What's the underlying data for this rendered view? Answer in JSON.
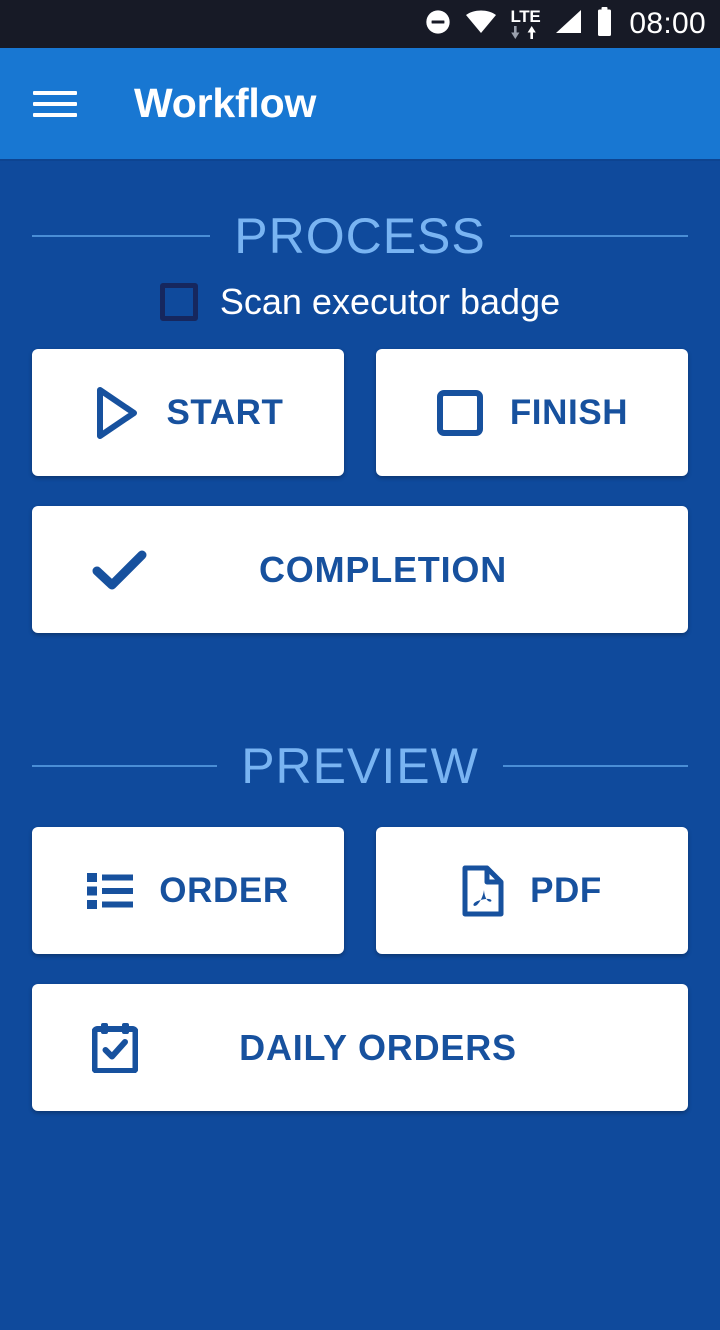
{
  "status_bar": {
    "time": "08:00",
    "lte_label": "LTE",
    "icons": [
      "do-not-disturb-icon",
      "wifi-icon",
      "lte-data-icon",
      "signal-icon",
      "battery-icon"
    ]
  },
  "app_bar": {
    "title": "Workflow",
    "menu_icon": "hamburger-menu-icon"
  },
  "sections": [
    {
      "title": "PROCESS",
      "checkbox": {
        "label": "Scan executor badge",
        "checked": false
      },
      "buttons": [
        {
          "label": "START",
          "icon": "play-icon"
        },
        {
          "label": "FINISH",
          "icon": "stop-square-icon"
        },
        {
          "label": "COMPLETION",
          "icon": "check-icon"
        }
      ]
    },
    {
      "title": "PREVIEW",
      "buttons": [
        {
          "label": "ORDER",
          "icon": "list-icon"
        },
        {
          "label": "PDF",
          "icon": "pdf-file-icon"
        },
        {
          "label": "DAILY ORDERS",
          "icon": "calendar-check-icon"
        }
      ]
    }
  ],
  "colors": {
    "background": "#0f4a9c",
    "app_bar": "#1877d2",
    "status_bar": "#171a26",
    "accent_text": "#17519e",
    "section_title": "#79b4f2",
    "card": "#ffffff",
    "checkbox_border": "#16275e"
  }
}
